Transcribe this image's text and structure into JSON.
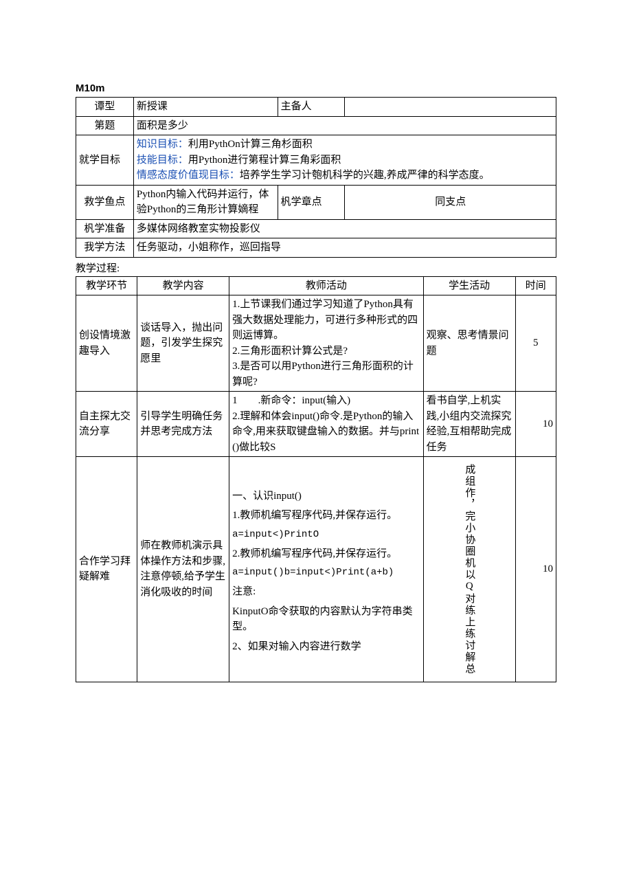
{
  "heading": "M10m",
  "t1": {
    "r1c1": "谭型",
    "r1c2": "新授课",
    "r1c3": "主备人",
    "r1c4": "",
    "r2c1": "第题",
    "r2c2": "面积是多少",
    "r3c1": "就学目标",
    "r3_l1a": "知识目标：",
    "r3_l1b": "利用PythOn计算三角杉面积",
    "r3_l2a": "技能目标：",
    "r3_l2b": "用Python进行第程计算三角彩面积",
    "r3_l3a": "情感态度价值现目标：",
    "r3_l3b": "培养学生学习计匏机科学的兴趣,养成严律的科学态度。",
    "r4c1": "救学鱼点",
    "r4c2": "Python内输入代码并运行，体验Python的三角形计算嫡程",
    "r4c3": "杋学章点",
    "r4c4": "同支点",
    "r5c1": "杋学准备",
    "r5c2": "多媒体网络教室实物投影仪",
    "r6c1": "我学方法",
    "r6c2": "任务驱动，小姐称作，巡回指导"
  },
  "proc_label": "教学过程:",
  "t2": {
    "h1": "教学环节",
    "h2": "教学内容",
    "h3": "教师活动",
    "h4": "学生活动",
    "h5": "时间",
    "r1c1": "创设情境激趣导入",
    "r1c2": "谈话导入，抛出问题，引发学生探究愿里",
    "r1c3a": "1.上节课我们通过学习知道了Python具有强大数据处理能力，可进行多种形式的四则",
    "r1c3b": "博算。",
    "r1c3c": "2.三角形面积计算公式是?",
    "r1c3d": "3.是否可以用Python进行三角形面积的计算呢?",
    "r1_underlined": "运",
    "r1c4": "观察、思考情景问题",
    "r1c5": "5",
    "r2c1": "自主探尢交流分享",
    "r2c2": "引导学生明确任务并思考完成方法",
    "r2c3a": "1　　.新命令：input(输入)",
    "r2c3b": "2.理解和体会input()命令.是Python的输入命令,用来获取键盘输入的数据。并与print()做比较S",
    "r2c4": "看书自学,上机实践,小组内交流探究经验,互相帮助完成任务",
    "r2c5": "10",
    "r3c1": "合作学习拜疑解难",
    "r3c2": "师在教师机演示具体操作方法和步骤,注意停顿,给予学生消化吸收的时间",
    "r3c3_1": "一、认识input()",
    "r3c3_2": "1.教师机编写程序代码,并保存运行。",
    "r3c3_3": "a=input<)PrintO",
    "r3c3_4": "2.教师机编写程序代码,并保存运行。",
    "r3c3_5": "a=input()b=input<)Print(a+b)",
    "r3c3_6": "注意:",
    "r3c3_7": "KinputO命令获取的内容默认为字符串类型。",
    "r3c3_8": "2、如果对输入内容进行数学",
    "r3c4": "成组作，完小协圈机以Q对练上练讨解总",
    "r3c5": "10"
  }
}
